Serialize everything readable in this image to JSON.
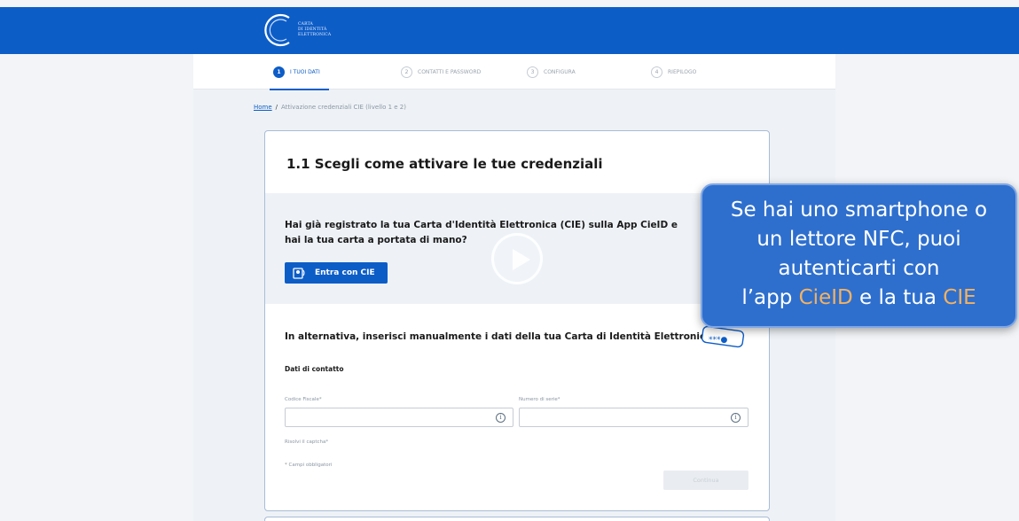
{
  "header": {
    "logo_text_line1": "CARTA",
    "logo_text_line2": "DI IDENTITÀ",
    "logo_text_line3": "ELETTRONICA"
  },
  "stepper": {
    "steps": [
      {
        "num": "1",
        "label": "I TUOI DATI",
        "active": true
      },
      {
        "num": "2",
        "label": "CONTATTI E PASSWORD",
        "active": false
      },
      {
        "num": "3",
        "label": "CONFIGURA",
        "active": false
      },
      {
        "num": "4",
        "label": "RIEPILOGO",
        "active": false
      }
    ]
  },
  "breadcrumb": {
    "home": "Home",
    "separator": "/",
    "current": "Attivazione credenziali CIE (livello 1 e 2)"
  },
  "card": {
    "title": "1.1 Scegli come attivare le tue credenziali",
    "cie_question": "Hai già registrato la tua Carta d'Identità Elettronica (CIE) sulla App CieID e hai la tua carta a portata di mano?",
    "cie_button_label": "Entra con CIE",
    "alt_title": "In alternativa, inserisci manualmente i dati della tua Carta di Identità Elettronica",
    "contact_title": "Dati di contatto",
    "codice_fiscale_label": "Codice Fiscale*",
    "codice_fiscale_value": "",
    "numero_serie_label": "Numero di serie*",
    "numero_serie_value": "",
    "captcha_label": "Risolvi il captcha*",
    "required_note": "* Campi obbligatori",
    "continue_label": "Continua",
    "pin_icon_text": "***●"
  },
  "overlay_caption": {
    "line1": "Se hai uno smartphone o",
    "line2": "un lettore NFC, puoi",
    "line3": "autenticarti con",
    "line4_prefix": "l’app ",
    "line4_hl1": "CieID",
    "line4_mid": " e la tua ",
    "line4_hl2": "CIE",
    "highlight_color": "#f4b260"
  },
  "colors": {
    "brand_blue": "#0d5dc7",
    "bubble_blue": "#2e6fce"
  }
}
